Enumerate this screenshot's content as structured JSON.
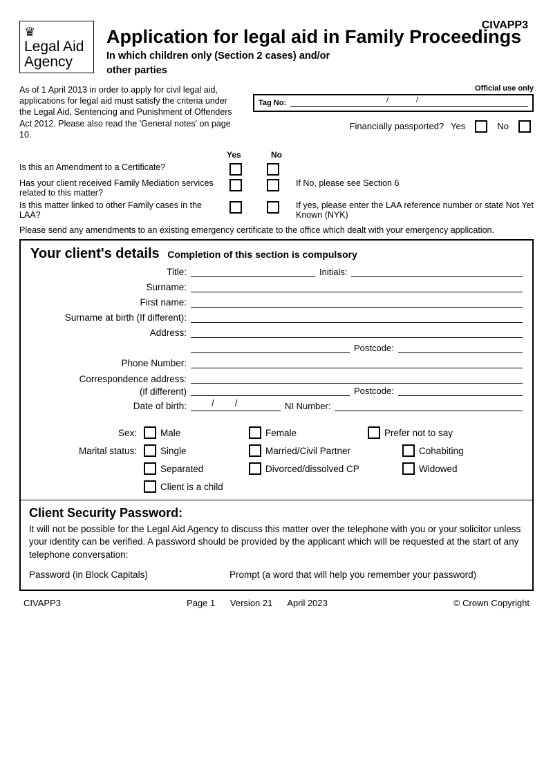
{
  "form_id": "CIVAPP3",
  "logo": {
    "org_line1": "Legal Aid",
    "org_line2": "Agency"
  },
  "title": "Application for legal aid in Family Proceedings",
  "subtitle_line1": "In which children only (Section 2 cases) and/or",
  "subtitle_line2": "other parties",
  "leftnote": "As of 1 April 2013 in order to apply for civil legal aid, applications for legal aid must satisfy the criteria under the Legal Aid, Sentencing and Punishment of Offenders Act 2012. Please also read the 'General notes' on page 10.",
  "official": {
    "header": "Official use only",
    "tag_label": "Tag No:",
    "passport_q": "Financially passported?",
    "yes": "Yes",
    "no": "No"
  },
  "yn": {
    "yes": "Yes",
    "no": "No",
    "q1": "Is this an Amendment to a Certificate?",
    "note1": "",
    "q2": "Has your client received Family Mediation services related to this matter?",
    "note2": "If No, please see Section 6",
    "q3": "Is this matter linked to other Family cases in the LAA?",
    "note3": "If yes, please enter the LAA reference number or state Not Yet Known (NYK)"
  },
  "final_note": "Please send any amendments to an existing emergency certificate to the office which dealt with your emergency application.",
  "client": {
    "section_title": "Your client's details",
    "section_sub": "Completion of this section is compulsory",
    "labels": {
      "title": "Title:",
      "initials": "Initials:",
      "surname": "Surname:",
      "firstname": "First name:",
      "surname_birth": "Surname at birth (If different):",
      "address": "Address:",
      "postcode": "Postcode:",
      "phone": "Phone Number:",
      "corr1": "Correspondence address:",
      "corr2": "(if different)",
      "dob": "Date of birth:",
      "ni": "NI Number:",
      "sex": "Sex:",
      "marital": "Marital status:"
    },
    "sex": {
      "male": "Male",
      "female": "Female",
      "prefer": "Prefer not to say"
    },
    "marital": {
      "single": "Single",
      "married": "Married/Civil Partner",
      "cohab": "Cohabiting",
      "sep": "Separated",
      "div": "Divorced/dissolved CP",
      "wid": "Widowed",
      "child": "Client is a child"
    }
  },
  "security": {
    "title": "Client Security Password:",
    "body": "It will not be possible for the Legal Aid Agency to discuss this matter over the telephone with you or your solicitor unless your identity can be verified.  A password should be provided by the applicant which will be requested at the start of any telephone conversation:",
    "pw_label": "Password (in Block Capitals)",
    "prompt_label": "Prompt (a word that will help you remember your password)"
  },
  "footer": {
    "left": "CIVAPP3",
    "center_a": "Page 1",
    "center_b": "Version 21",
    "center_c": "April 2023",
    "right": "© Crown Copyright"
  }
}
